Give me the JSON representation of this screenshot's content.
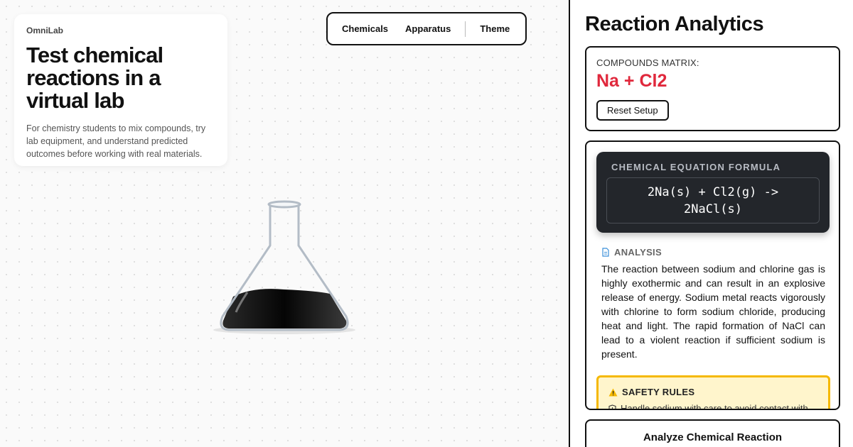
{
  "intro": {
    "brand": "OmniLab",
    "headline": "Test chemical reactions in a virtual lab",
    "description": "For chemistry students to mix compounds, try lab equipment, and understand predicted outcomes before working with real materials."
  },
  "toolbar": {
    "chemicals_label": "Chemicals",
    "apparatus_label": "Apparatus",
    "theme_label": "Theme"
  },
  "flask": {
    "liquid_color": "#111111"
  },
  "panel": {
    "title": "Reaction Analytics",
    "compounds_label": "COMPOUNDS MATRIX:",
    "compounds_value": "Na + Cl2",
    "reset_label": "Reset Setup",
    "formula_label": "CHEMICAL EQUATION FORMULA",
    "formula": "2Na(s) + Cl2(g) -> 2NaCl(s)",
    "analysis_label": "ANALYSIS",
    "analysis_text": "The reaction between sodium and chlorine gas is highly exothermic and can result in an explosive release of energy. Sodium metal reacts vigorously with chlorine to form sodium chloride, producing heat and light. The rapid formation of NaCl can lead to a violent reaction if sufficient sodium is present.",
    "safety_label": "SAFETY RULES",
    "safety_item": "Handle sodium with care to avoid contact with",
    "analyze_label": "Analyze Chemical Reaction"
  },
  "colors": {
    "accent_red": "#e0283c",
    "warning_yellow": "#f5b800",
    "dark_card": "#23262b"
  }
}
